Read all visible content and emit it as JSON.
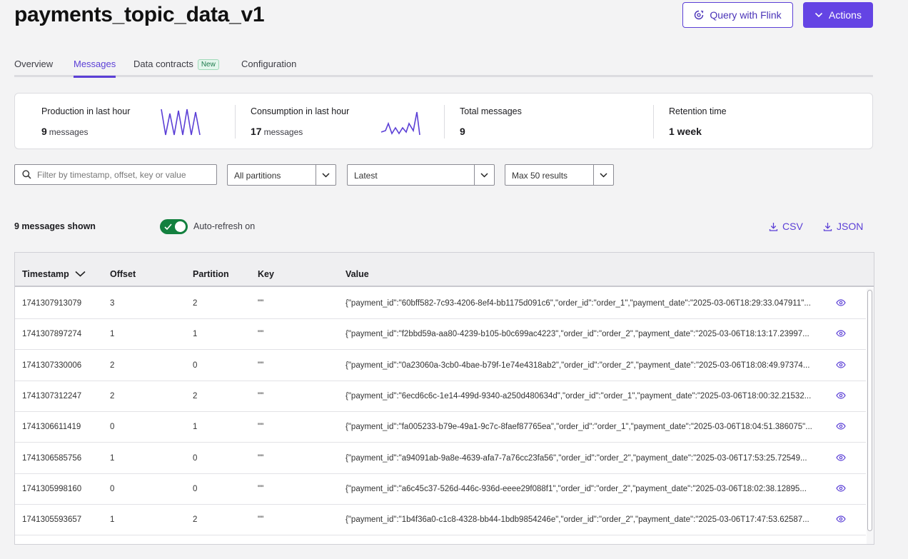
{
  "page": {
    "title": "payments_topic_data_v1"
  },
  "header": {
    "flink_button": "Query with Flink",
    "actions_button": "Actions"
  },
  "tabs": [
    {
      "label": "Overview"
    },
    {
      "label": "Messages"
    },
    {
      "label": "Data contracts",
      "badge": "New"
    },
    {
      "label": "Configuration"
    }
  ],
  "stats": {
    "production": {
      "label": "Production in last hour",
      "value": "9",
      "unit": "messages"
    },
    "consumption": {
      "label": "Consumption in last hour",
      "value": "17",
      "unit": "messages"
    },
    "total": {
      "label": "Total messages",
      "value": "9"
    },
    "retention": {
      "label": "Retention time",
      "value": "1 week"
    }
  },
  "filters": {
    "search_placeholder": "Filter by timestamp, offset, key or value",
    "partitions": "All partitions",
    "position": "Latest",
    "max_results": "Max 50 results"
  },
  "toolbar": {
    "shown": "9 messages shown",
    "auto_refresh": "Auto-refresh on",
    "csv": "CSV",
    "json": "JSON"
  },
  "table": {
    "headers": {
      "timestamp": "Timestamp",
      "offset": "Offset",
      "partition": "Partition",
      "key": "Key",
      "value": "Value"
    },
    "rows": [
      {
        "timestamp": "1741307913079",
        "offset": "3",
        "partition": "2",
        "key": "\"\"",
        "value": "{\"payment_id\":\"60bff582-7c93-4206-8ef4-bb1175d091c6\",\"order_id\":\"order_1\",\"payment_date\":\"2025-03-06T18:29:33.047911\"..."
      },
      {
        "timestamp": "1741307897274",
        "offset": "1",
        "partition": "1",
        "key": "\"\"",
        "value": "{\"payment_id\":\"f2bbd59a-aa80-4239-b105-b0c699ac4223\",\"order_id\":\"order_2\",\"payment_date\":\"2025-03-06T18:13:17.23997..."
      },
      {
        "timestamp": "1741307330006",
        "offset": "2",
        "partition": "0",
        "key": "\"\"",
        "value": "{\"payment_id\":\"0a23060a-3cb0-4bae-b79f-1e74e4318ab2\",\"order_id\":\"order_2\",\"payment_date\":\"2025-03-06T18:08:49.97374..."
      },
      {
        "timestamp": "1741307312247",
        "offset": "2",
        "partition": "2",
        "key": "\"\"",
        "value": "{\"payment_id\":\"6ecd6c6c-1e14-499d-9340-a250d480634d\",\"order_id\":\"order_1\",\"payment_date\":\"2025-03-06T18:00:32.21532..."
      },
      {
        "timestamp": "1741306611419",
        "offset": "0",
        "partition": "1",
        "key": "\"\"",
        "value": "{\"payment_id\":\"fa005233-b79e-49a1-9c7c-8faef87765ea\",\"order_id\":\"order_1\",\"payment_date\":\"2025-03-06T18:04:51.386075\"..."
      },
      {
        "timestamp": "1741306585756",
        "offset": "1",
        "partition": "0",
        "key": "\"\"",
        "value": "{\"payment_id\":\"a94091ab-9a8e-4639-afa7-7a76cc23fa56\",\"order_id\":\"order_2\",\"payment_date\":\"2025-03-06T17:53:25.72549..."
      },
      {
        "timestamp": "1741305998160",
        "offset": "0",
        "partition": "0",
        "key": "\"\"",
        "value": "{\"payment_id\":\"a6c45c37-526d-446c-936d-eeee29f088f1\",\"order_id\":\"order_2\",\"payment_date\":\"2025-03-06T18:02:38.12895..."
      },
      {
        "timestamp": "1741305593657",
        "offset": "1",
        "partition": "2",
        "key": "\"\"",
        "value": "{\"payment_id\":\"1b4f36a0-c1c8-4328-bb44-1bdb9854246e\",\"order_id\":\"order_2\",\"payment_date\":\"2025-03-06T17:47:53.62587..."
      }
    ]
  },
  "icons": {
    "flink": "flink-icon",
    "actions": "chevron-down-icon",
    "search": "search-icon",
    "download": "download-icon",
    "view": "eye-icon",
    "sort": "sort-desc-icon",
    "toggle": "check-icon"
  },
  "colors": {
    "accent": "#6444e4",
    "toggle_on": "#13803f",
    "sparkline": "#5b3fd6"
  }
}
